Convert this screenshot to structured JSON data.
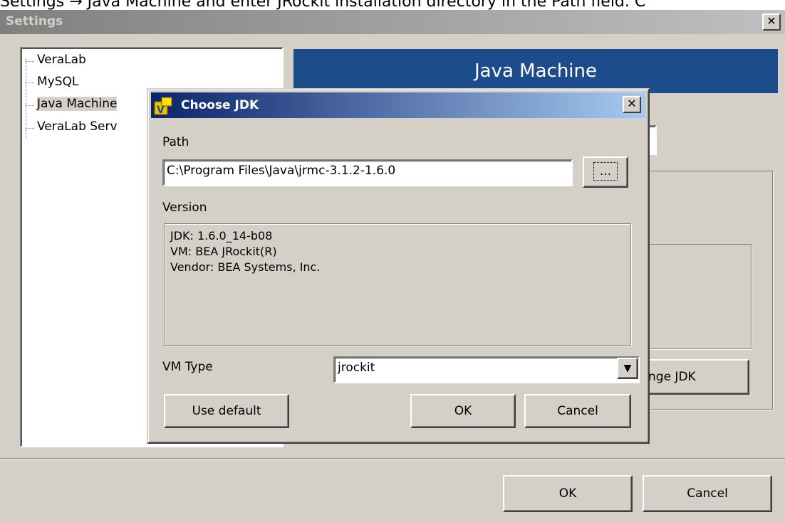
{
  "caption": "Settings → Java Machine and enter JRockit installation directory in the Path field. C",
  "settings": {
    "title": "Settings",
    "close_label": "✕",
    "tree": [
      "VeraLab",
      "MySQL",
      "Java Machine",
      "VeraLab Serv"
    ],
    "header": "Java Machine",
    "change_jdk_label": "nge JDK",
    "ok_label": "OK",
    "cancel_label": "Cancel"
  },
  "dialog": {
    "title": "Choose JDK",
    "close_label": "✕",
    "path_label": "Path",
    "path_value": "C:\\Program Files\\Java\\jrmc-3.1.2-1.6.0",
    "browse_label": "...",
    "version_label": "Version",
    "version_lines": [
      "JDK: 1.6.0_14-b08",
      "VM: BEA JRockit(R)",
      "Vendor: BEA Systems, Inc."
    ],
    "vm_type_label": "VM Type",
    "vm_type_value": "jrockit",
    "use_default_label": "Use default",
    "ok_label": "OK",
    "cancel_label": "Cancel"
  },
  "colors": {
    "header_bg": "#1c4d8a",
    "dialog_title_bg": "#0a246a",
    "window_bg": "#d4d0c8"
  }
}
